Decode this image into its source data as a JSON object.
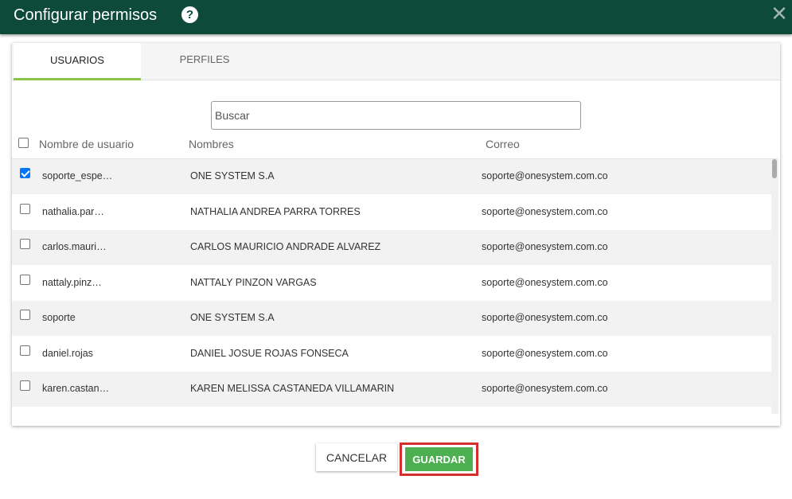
{
  "dialog": {
    "title": "Configurar permisos",
    "help_icon": "question-circle-icon",
    "close_icon": "close-icon",
    "close_glyph": "✕",
    "help_glyph": "?"
  },
  "tabs": [
    {
      "label": "USUARIOS",
      "active": true
    },
    {
      "label": "PERFILES",
      "active": false
    }
  ],
  "search": {
    "placeholder": "Buscar",
    "value": ""
  },
  "table": {
    "columns": [
      "Nombre de usuario",
      "Nombres",
      "Correo"
    ],
    "rows": [
      {
        "username": "soporte_espe…",
        "name": "ONE SYSTEM S.A",
        "email": "soporte@onesystem.com.co",
        "checked": true
      },
      {
        "username": "nathalia.par…",
        "name": "NATHALIA ANDREA PARRA TORRES",
        "email": "soporte@onesystem.com.co",
        "checked": false
      },
      {
        "username": "carlos.mauri…",
        "name": "CARLOS MAURICIO ANDRADE ALVAREZ",
        "email": "soporte@onesystem.com.co",
        "checked": false
      },
      {
        "username": "nattaly.pinz…",
        "name": "NATTALY PINZON VARGAS",
        "email": "soporte@onesystem.com.co",
        "checked": false
      },
      {
        "username": "soporte",
        "name": "ONE SYSTEM S.A",
        "email": "soporte@onesystem.com.co",
        "checked": false
      },
      {
        "username": "daniel.rojas",
        "name": "DANIEL JOSUE ROJAS FONSECA",
        "email": "soporte@onesystem.com.co",
        "checked": false
      },
      {
        "username": "karen.castan…",
        "name": "KAREN MELISSA CASTANEDA VILLAMARIN",
        "email": "soporte@onesystem.com.co",
        "checked": false
      }
    ]
  },
  "buttons": {
    "cancel": "CANCELAR",
    "save": "GUARDAR"
  },
  "colors": {
    "header": "#0d4a3a",
    "tab_accent": "#8bc34a",
    "save": "#4caf50",
    "highlight": "#d32f2f",
    "checkbox": "#0075ff"
  }
}
